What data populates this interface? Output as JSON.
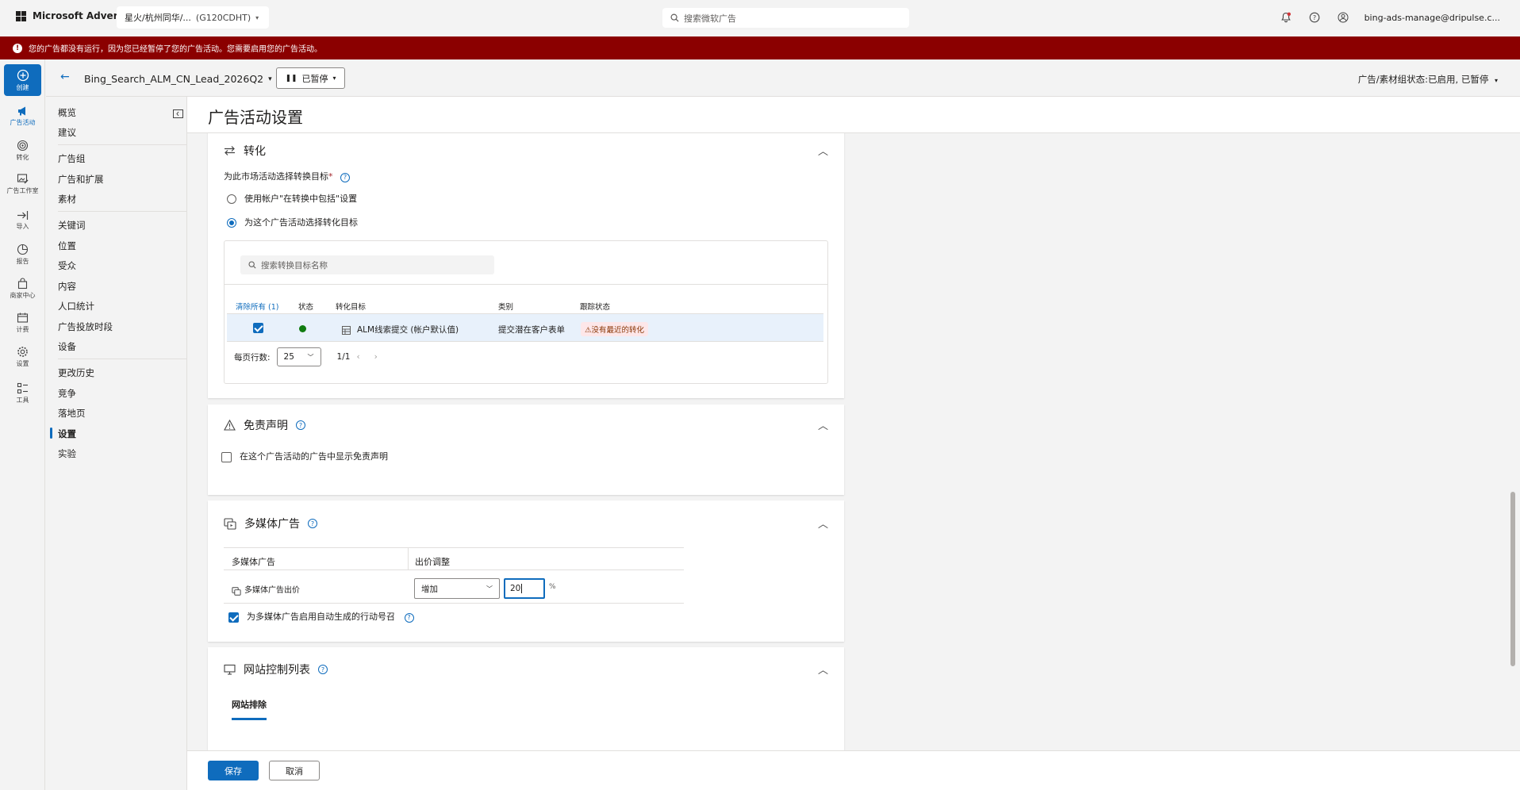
{
  "topbar": {
    "brand": "Microsoft Advertising",
    "account_name": "星火/杭州同华/...",
    "account_id": "(G120CDHT)",
    "search_placeholder": "搜索微软广告",
    "user_email": "bing-ads-manage@dripulse.c..."
  },
  "banner": {
    "message": "您的广告都没有运行，因为您已经暂停了您的广告活动。您需要启用您的广告活动。"
  },
  "rail": {
    "create": "创建",
    "items": [
      "广告活动",
      "转化",
      "广告工作室",
      "导入",
      "报告",
      "商家中心",
      "计费",
      "设置",
      "工具"
    ]
  },
  "header": {
    "campaign_name": "Bing_Search_ALM_CN_Lead_2026Q2",
    "status_button": "已暂停",
    "right_status": "广告/素材组状态:已启用, 已暂停"
  },
  "nav": {
    "items": [
      "概览",
      "建议",
      "广告组",
      "广告和扩展",
      "素材",
      "关键词",
      "位置",
      "受众",
      "内容",
      "人口统计",
      "广告投放时段",
      "设备",
      "更改历史",
      "竞争",
      "落地页",
      "设置",
      "实验"
    ]
  },
  "page": {
    "title": "广告活动设置"
  },
  "conversion": {
    "title": "转化",
    "question": "为此市场活动选择转换目标",
    "required_mark": "*",
    "option1": "使用帐户\"在转换中包括\"设置",
    "option2": "为这个广告活动选择转化目标",
    "search_placeholder": "搜索转换目标名称",
    "columns": {
      "clear": "清除所有 (1)",
      "status": "状态",
      "goal": "转化目标",
      "category": "类别",
      "tracking": "跟踪状态"
    },
    "row": {
      "goal": "ALM线索提交 (帐户默认值)",
      "category": "提交潜在客户表单",
      "tracking": "没有最近的转化"
    },
    "pager": {
      "label": "每页行数:",
      "rows": "25",
      "page": "1/1"
    }
  },
  "disclaimer": {
    "title": "免责声明",
    "checkbox": "在这个广告活动的广告中显示免责声明"
  },
  "multimedia": {
    "title": "多媒体广告",
    "col1": "多媒体广告",
    "col2": "出价调整",
    "row_label": "多媒体广告出价",
    "bid_mode": "增加",
    "bid_value": "20",
    "unit": "%",
    "auto_cta": "为多媒体广告启用自动生成的行动号召"
  },
  "site_control": {
    "title": "网站控制列表",
    "tab": "网站排除"
  },
  "footer": {
    "save": "保存",
    "cancel": "取消"
  },
  "colors": {
    "accent": "#0f6cbd",
    "banner": "#8b0000",
    "active_status": "#107c10"
  }
}
